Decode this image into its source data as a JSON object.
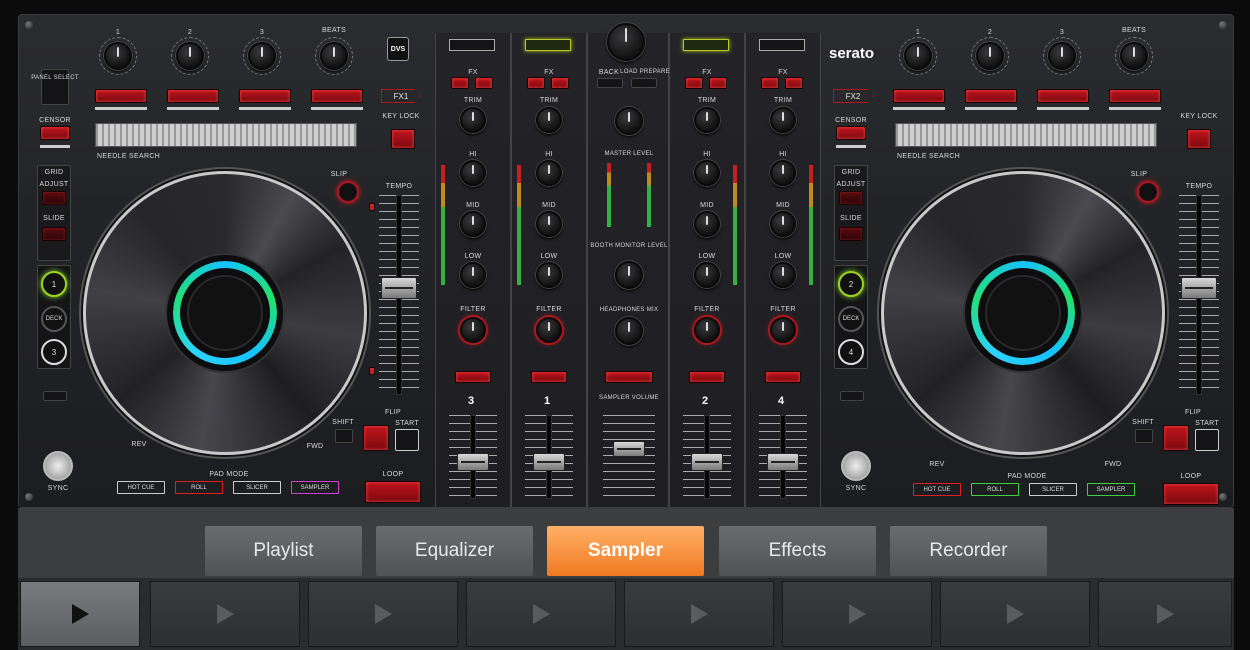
{
  "controller": {
    "brand": "serato",
    "dvs_badge": "DVS",
    "left_deck": {
      "fx_tag": "FX1",
      "beats_label": "BEATS",
      "knob_numbers": [
        "1",
        "2",
        "3"
      ],
      "needle_search": "NEEDLE SEARCH",
      "tempo": "TEMPO",
      "slip": "SLIP",
      "panel_select": "PANEL SELECT",
      "censor": "CENSOR",
      "grid": "GRID",
      "adjust": "ADJUST",
      "slide": "SLIDE",
      "deck_top": "1",
      "deck": "DECK",
      "deck_bottom": "3",
      "key_lock": "KEY LOCK",
      "shift": "SHIFT",
      "flip": "FLIP",
      "start": "START",
      "rev": "REV",
      "fwd": "FWD",
      "pad_mode": "PAD MODE",
      "pad_modes": [
        "HOT CUE",
        "ROLL",
        "SLICER",
        "SAMPLER"
      ],
      "loop": "LOOP",
      "sync": "SYNC"
    },
    "right_deck": {
      "fx_tag": "FX2",
      "beats_label": "BEATS",
      "knob_numbers": [
        "1",
        "2",
        "3"
      ],
      "needle_search": "NEEDLE SEARCH",
      "tempo": "TEMPO",
      "slip": "SLIP",
      "censor": "CENSOR",
      "grid": "GRID",
      "adjust": "ADJUST",
      "slide": "SLIDE",
      "deck_top": "2",
      "deck": "DECK",
      "deck_bottom": "4",
      "key_lock": "KEY LOCK",
      "shift": "SHIFT",
      "flip": "FLIP",
      "start": "START",
      "rev": "REV",
      "fwd": "FWD",
      "pad_mode": "PAD MODE",
      "pad_modes": [
        "HOT CUE",
        "ROLL",
        "SLICER",
        "SAMPLER"
      ],
      "loop": "LOOP",
      "sync": "SYNC"
    },
    "mixer": {
      "fx": "FX",
      "trim": "TRIM",
      "hi": "HI",
      "mid": "MID",
      "low": "LOW",
      "filter": "FILTER",
      "channels": [
        "3",
        "1",
        "2",
        "4"
      ],
      "master_level": "MASTER LEVEL",
      "booth_monitor_level": "BOOTH MONITOR LEVEL",
      "headphones_mix": "HEADPHONES MIX",
      "sampler_volume": "SAMPLER VOLUME",
      "back": "BACK",
      "load_prepare": "LOAD PREPARE"
    }
  },
  "tabs": [
    {
      "label": "Playlist",
      "active": false
    },
    {
      "label": "Equalizer",
      "active": false
    },
    {
      "label": "Sampler",
      "active": true
    },
    {
      "label": "Effects",
      "active": false
    },
    {
      "label": "Recorder",
      "active": false
    }
  ],
  "sampler_pads": [
    {
      "icon": "play-icon",
      "active": true
    },
    {
      "icon": "play-icon",
      "active": false
    },
    {
      "icon": "play-icon",
      "active": false
    },
    {
      "icon": "play-icon",
      "active": false
    },
    {
      "icon": "play-icon",
      "active": false
    },
    {
      "icon": "play-icon",
      "active": false
    },
    {
      "icon": "play-icon",
      "active": false
    },
    {
      "icon": "play-icon",
      "active": false
    }
  ],
  "colors": {
    "accent_orange": "#f07a22",
    "ring_cyan": "#16c2ff",
    "ring_green": "#21e36a",
    "pad_red": "#c0141c"
  }
}
